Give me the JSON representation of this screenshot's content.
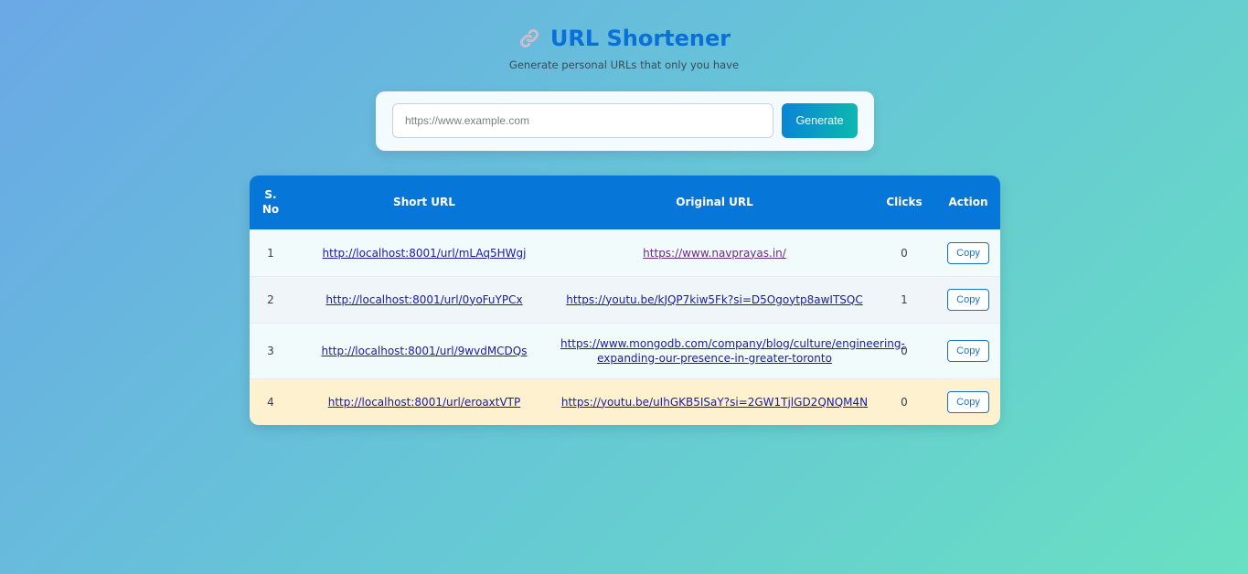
{
  "header": {
    "icon": "link-icon",
    "title": "URL Shortener",
    "subtitle": "Generate personal URLs that only you have"
  },
  "form": {
    "input_value": "",
    "input_placeholder": "https://www.example.com",
    "generate_label": "Generate"
  },
  "table": {
    "headers": {
      "sno_line1": "S.",
      "sno_line2": "No",
      "short_url": "Short URL",
      "original_url": "Original URL",
      "clicks": "Clicks",
      "action": "Action"
    },
    "rows": [
      {
        "sno": "1",
        "short_url": "http://localhost:8001/url/mLAq5HWgj",
        "original_url": "https://www.navprayas.in/",
        "clicks": "0",
        "action": "Copy"
      },
      {
        "sno": "2",
        "short_url": "http://localhost:8001/url/0yoFuYPCx",
        "original_url": "https://youtu.be/kJQP7kiw5Fk?si=D5Ogoytp8awITSQC",
        "clicks": "1",
        "action": "Copy"
      },
      {
        "sno": "3",
        "short_url": "http://localhost:8001/url/9wvdMCDQs",
        "original_url_line1": "https://www.mongodb.com/company/blog/culture/engineering-",
        "original_url_line2": "expanding-our-presence-in-greater-toronto",
        "clicks": "0",
        "action": "Copy"
      },
      {
        "sno": "4",
        "short_url": "http://localhost:8001/url/eroaxtVTP",
        "original_url": "https://youtu.be/uIhGKB5ISaY?si=2GW1TjlGD2QNQM4N",
        "clicks": "0",
        "action": "Copy"
      }
    ]
  },
  "colors": {
    "accent": "#0a6fd6",
    "header_row": "#0677d9",
    "highlight_row": "#fdf1cf"
  }
}
